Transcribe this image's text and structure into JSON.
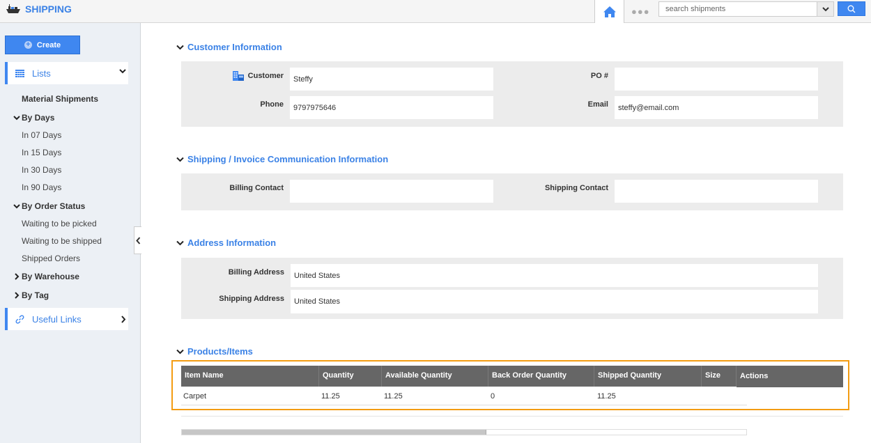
{
  "app": {
    "title": "SHIPPING",
    "brand_color": "#3b82e6",
    "accent_color": "#3f87f0",
    "highlight_color": "#f39c12"
  },
  "topbar": {
    "home_icon": "home-icon",
    "more_icon": "ellipsis-icon",
    "more_label": "●●●",
    "search": {
      "placeholder": "search shipments",
      "value": ""
    },
    "search_icon": "search-icon"
  },
  "sidebar": {
    "create_label": "Create",
    "lists_label": "Lists",
    "useful_links_label": "Useful Links",
    "top_item": "Material Shipments",
    "groups": [
      {
        "label": "By Days",
        "expanded": true,
        "items": [
          "In 07 Days",
          "In 15 Days",
          "In 30 Days",
          "In 90 Days"
        ]
      },
      {
        "label": "By Order Status",
        "expanded": true,
        "items": [
          "Waiting to be picked",
          "Waiting to be shipped",
          "Shipped Orders"
        ]
      },
      {
        "label": "By Warehouse",
        "expanded": false,
        "items": []
      },
      {
        "label": "By Tag",
        "expanded": false,
        "items": []
      }
    ]
  },
  "sections": {
    "customer": {
      "title": "Customer Information",
      "customer_label": "Customer",
      "customer_value": "Steffy",
      "phone_label": "Phone",
      "phone_value": "9797975646",
      "po_label": "PO #",
      "po_value": "",
      "email_label": "Email",
      "email_value": "steffy@email.com"
    },
    "communication": {
      "title": "Shipping / Invoice Communication Information",
      "billing_contact_label": "Billing Contact",
      "billing_contact_value": "",
      "shipping_contact_label": "Shipping Contact",
      "shipping_contact_value": ""
    },
    "address": {
      "title": "Address Information",
      "billing_address_label": "Billing Address",
      "billing_address_value": "United States",
      "shipping_address_label": "Shipping Address",
      "shipping_address_value": "United States"
    },
    "products": {
      "title": "Products/Items",
      "columns": [
        "Item Name",
        "Quantity",
        "Available Quantity",
        "Back Order Quantity",
        "Shipped Quantity",
        "Size",
        "Actions"
      ],
      "rows": [
        [
          "Carpet",
          "11.25",
          "11.25",
          "0",
          "11.25",
          "",
          ""
        ]
      ],
      "scroll_position": 0.0,
      "scroll_visible_fraction": 0.54
    }
  }
}
